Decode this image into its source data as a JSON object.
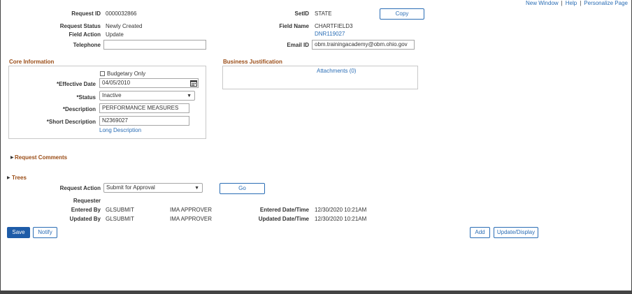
{
  "top_links": {
    "new_window": "New Window",
    "help": "Help",
    "personalize": "Personalize Page",
    "sep": "|"
  },
  "header": {
    "request_id_label": "Request ID",
    "request_id": "0000032866",
    "setid_label": "SetID",
    "setid": "STATE",
    "copy_label": "Copy",
    "request_status_label": "Request Status",
    "request_status": "Newly Created",
    "field_name_label": "Field Name",
    "field_name": "CHARTFIELD3",
    "field_action_label": "Field Action",
    "field_action": "Update",
    "field_value_link": "DNR119027",
    "telephone_label": "Telephone",
    "telephone": "",
    "email_label": "Email ID",
    "email": "obm.trainingacademy@obm.ohio.gov"
  },
  "core": {
    "title": "Core Information",
    "budgetary_label": "Budgetary Only",
    "effective_date_label": "*Effective Date",
    "effective_date": "04/05/2010",
    "status_label": "*Status",
    "status": "Inactive",
    "description_label": "*Description",
    "description": "PERFORMANCE MEASURES",
    "short_description_label": "*Short Description",
    "short_description": "N2369027",
    "long_description_link": "Long Description"
  },
  "business": {
    "title": "Business Justification",
    "attachments_link": "Attachments (0)"
  },
  "request_comments": {
    "title": "Request Comments"
  },
  "trees": {
    "title": "Trees"
  },
  "action": {
    "request_action_label": "Request Action",
    "request_action": "Submit for Approval",
    "go_label": "Go",
    "requester_label": "Requester",
    "entered_by_label": "Entered By",
    "entered_by_id": "GLSUBMIT",
    "entered_by_name": "IMA APPROVER",
    "entered_dt_label": "Entered Date/Time",
    "entered_dt": "12/30/2020 10:21AM",
    "updated_by_label": "Updated By",
    "updated_by_id": "GLSUBMIT",
    "updated_by_name": "IMA APPROVER",
    "updated_dt_label": "Updated Date/Time",
    "updated_dt": "12/30/2020 10:21AM"
  },
  "footer": {
    "save": "Save",
    "notify": "Notify",
    "add": "Add",
    "update_display": "Update/Display"
  },
  "colors": {
    "link": "#2a6db5",
    "section": "#9a4d17",
    "primary": "#1e5ca8"
  }
}
